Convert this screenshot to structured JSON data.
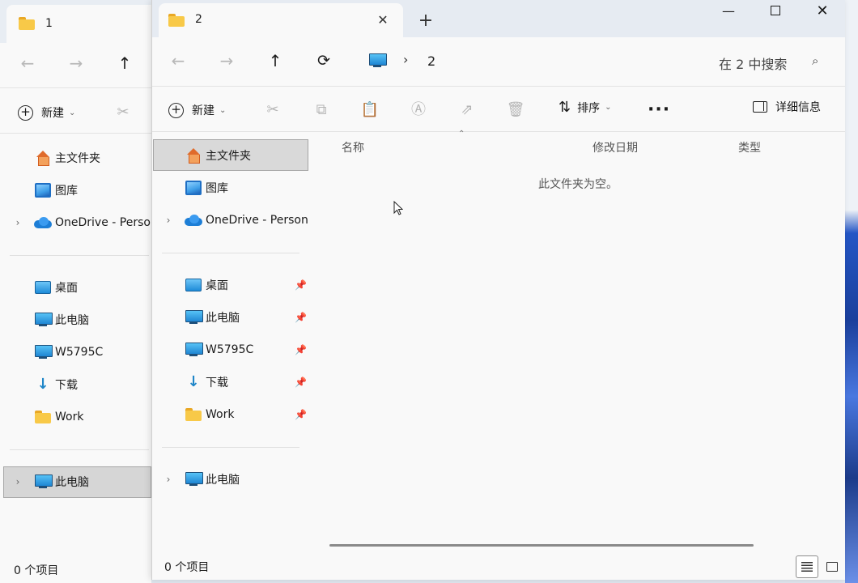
{
  "back_window": {
    "tab_title": "1",
    "nav": {
      "home": "主文件夹",
      "gallery": "图库",
      "onedrive": "OneDrive - Perso",
      "desktop": "桌面",
      "this_pc": "此电脑",
      "w5795c": "W5795C",
      "downloads": "下载",
      "work": "Work",
      "this_pc_tree": "此电脑"
    },
    "new_label": "新建",
    "status": "0 个项目"
  },
  "front_window": {
    "tab_title": "2",
    "address_path": "2",
    "search_placeholder": "在 2 中搜索",
    "toolbar": {
      "new_label": "新建",
      "sort_label": "排序",
      "details_label": "详细信息"
    },
    "nav": {
      "home": "主文件夹",
      "gallery": "图库",
      "onedrive": "OneDrive - Personal",
      "desktop": "桌面",
      "this_pc": "此电脑",
      "w5795c": "W5795C",
      "downloads": "下载",
      "work": "Work",
      "this_pc_tree": "此电脑"
    },
    "columns": {
      "name": "名称",
      "modified": "修改日期",
      "type": "类型"
    },
    "empty_message": "此文件夹为空。",
    "status": "0 个项目"
  }
}
